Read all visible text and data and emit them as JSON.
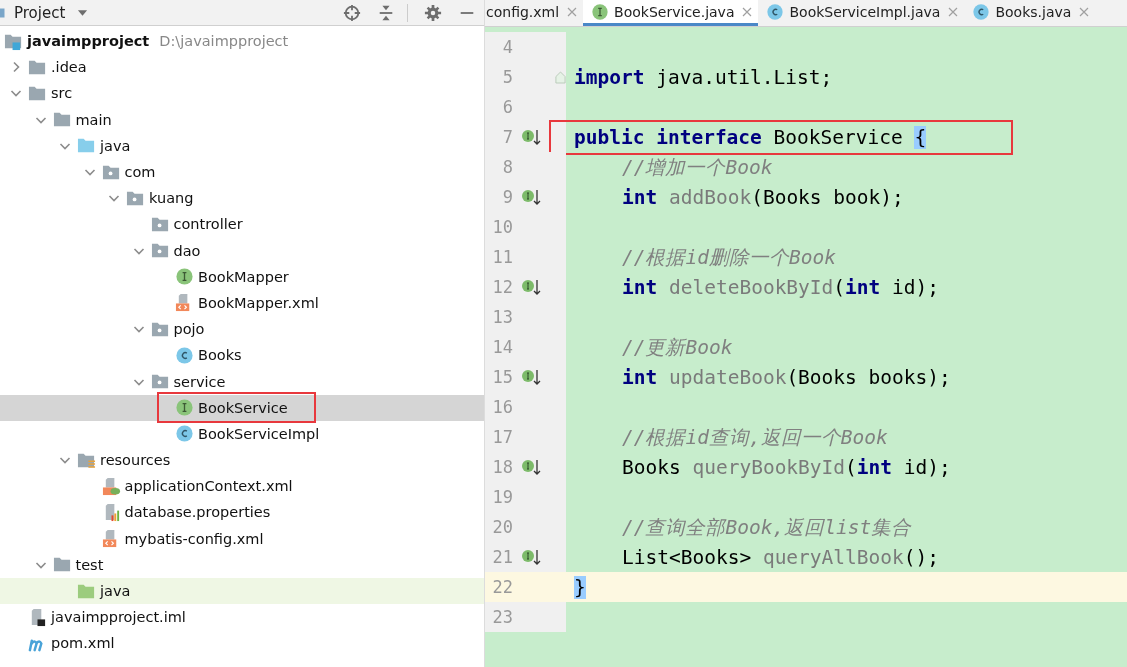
{
  "project_panel": {
    "title": "Project"
  },
  "tree": {
    "name": "javaimpproject",
    "path": "D:\\javaimpproject",
    "kind": "module",
    "selected": false,
    "boxed": false,
    "children": [
      {
        "name": ".idea",
        "kind": "folder",
        "expanded": false,
        "selected": false,
        "boxed": false
      },
      {
        "name": "src",
        "kind": "folder",
        "expanded": true,
        "selected": false,
        "boxed": false,
        "children": [
          {
            "name": "main",
            "kind": "folder",
            "expanded": true,
            "selected": false,
            "boxed": false,
            "children": [
              {
                "name": "java",
                "kind": "source-root",
                "expanded": true,
                "selected": false,
                "boxed": false,
                "children": [
                  {
                    "name": "com",
                    "kind": "package",
                    "expanded": true,
                    "selected": false,
                    "boxed": false,
                    "children": [
                      {
                        "name": "kuang",
                        "kind": "package",
                        "expanded": true,
                        "selected": false,
                        "boxed": false,
                        "children": [
                          {
                            "name": "controller",
                            "kind": "package",
                            "selected": false,
                            "boxed": false
                          },
                          {
                            "name": "dao",
                            "kind": "package",
                            "expanded": true,
                            "selected": false,
                            "boxed": false,
                            "children": [
                              {
                                "name": "BookMapper",
                                "kind": "interface",
                                "selected": false,
                                "boxed": false
                              },
                              {
                                "name": "BookMapper.xml",
                                "kind": "xml",
                                "selected": false,
                                "boxed": false
                              }
                            ]
                          },
                          {
                            "name": "pojo",
                            "kind": "package",
                            "expanded": true,
                            "selected": false,
                            "boxed": false,
                            "children": [
                              {
                                "name": "Books",
                                "kind": "class",
                                "selected": false,
                                "boxed": false
                              }
                            ]
                          },
                          {
                            "name": "service",
                            "kind": "package",
                            "expanded": true,
                            "selected": false,
                            "boxed": false,
                            "children": [
                              {
                                "name": "BookService",
                                "kind": "interface",
                                "selected": true,
                                "boxed": true
                              },
                              {
                                "name": "BookServiceImpl",
                                "kind": "class",
                                "selected": false,
                                "boxed": false
                              }
                            ]
                          }
                        ]
                      }
                    ]
                  }
                ]
              },
              {
                "name": "resources",
                "kind": "resources-root",
                "expanded": true,
                "selected": false,
                "boxed": false,
                "children": [
                  {
                    "name": "applicationContext.xml",
                    "kind": "spring-xml",
                    "selected": false,
                    "boxed": false
                  },
                  {
                    "name": "database.properties",
                    "kind": "properties",
                    "selected": false,
                    "boxed": false
                  },
                  {
                    "name": "mybatis-config.xml",
                    "kind": "xml",
                    "selected": false,
                    "boxed": false
                  }
                ]
              }
            ]
          },
          {
            "name": "test",
            "kind": "folder",
            "expanded": true,
            "selected": false,
            "boxed": false,
            "children": [
              {
                "name": "java",
                "kind": "test-root",
                "selected": false,
                "boxed": false
              }
            ]
          }
        ]
      },
      {
        "name": "javaimpproject.iml",
        "kind": "iml",
        "selected": false,
        "boxed": false
      },
      {
        "name": "pom.xml",
        "kind": "maven",
        "selected": false,
        "boxed": false
      }
    ]
  },
  "tabs": [
    {
      "label": "config.xml",
      "kind": "none",
      "selected": false
    },
    {
      "label": "BookService.java",
      "kind": "interface",
      "selected": true
    },
    {
      "label": "BookServiceImpl.java",
      "kind": "class",
      "selected": false
    },
    {
      "label": "Books.java",
      "kind": "class",
      "selected": false
    }
  ],
  "code_lines": [
    {
      "number": "4",
      "kind": "plain",
      "current": false,
      "boxed": false
    },
    {
      "number": "5",
      "kind": "fold",
      "indented": false,
      "current": false,
      "boxed": false,
      "tokens": [
        {
          "text": "import",
          "kind": "keyword"
        },
        {
          "text": " java.util.List;",
          "kind": "plain"
        }
      ]
    },
    {
      "number": "6",
      "kind": "plain",
      "current": false,
      "boxed": false
    },
    {
      "number": "7",
      "kind": "implemented",
      "indented": false,
      "current": false,
      "boxed": true,
      "tokens": [
        {
          "text": "public interface",
          "kind": "keyword"
        },
        {
          "text": " BookService ",
          "kind": "plain"
        },
        {
          "text": "{",
          "kind": "brace"
        }
      ]
    },
    {
      "number": "8",
      "kind": "plain",
      "indented": true,
      "current": false,
      "boxed": false,
      "tokens": [
        {
          "text": "//增加一个Book",
          "kind": "comment"
        }
      ]
    },
    {
      "number": "9",
      "kind": "implemented",
      "indented": true,
      "current": false,
      "boxed": false,
      "tokens": [
        {
          "text": "int",
          "kind": "keyword"
        },
        {
          "text": " addBook",
          "kind": "method"
        },
        {
          "text": "(Books book);",
          "kind": "plain"
        }
      ]
    },
    {
      "number": "10",
      "kind": "plain",
      "current": false,
      "boxed": false
    },
    {
      "number": "11",
      "kind": "plain",
      "indented": true,
      "current": false,
      "boxed": false,
      "tokens": [
        {
          "text": "//根据id删除一个Book",
          "kind": "comment"
        }
      ]
    },
    {
      "number": "12",
      "kind": "implemented",
      "indented": true,
      "current": false,
      "boxed": false,
      "tokens": [
        {
          "text": "int",
          "kind": "keyword"
        },
        {
          "text": " deleteBookById",
          "kind": "method"
        },
        {
          "text": "(",
          "kind": "plain"
        },
        {
          "text": "int",
          "kind": "keyword"
        },
        {
          "text": " id);",
          "kind": "plain"
        }
      ]
    },
    {
      "number": "13",
      "kind": "plain",
      "current": false,
      "boxed": false
    },
    {
      "number": "14",
      "kind": "plain",
      "indented": true,
      "current": false,
      "boxed": false,
      "tokens": [
        {
          "text": "//更新Book",
          "kind": "comment"
        }
      ]
    },
    {
      "number": "15",
      "kind": "implemented",
      "indented": true,
      "current": false,
      "boxed": false,
      "tokens": [
        {
          "text": "int",
          "kind": "keyword"
        },
        {
          "text": " updateBook",
          "kind": "method"
        },
        {
          "text": "(Books books);",
          "kind": "plain"
        }
      ]
    },
    {
      "number": "16",
      "kind": "plain",
      "current": false,
      "boxed": false
    },
    {
      "number": "17",
      "kind": "plain",
      "indented": true,
      "current": false,
      "boxed": false,
      "tokens": [
        {
          "text": "//根据id查询,返回一个Book",
          "kind": "comment"
        }
      ]
    },
    {
      "number": "18",
      "kind": "implemented",
      "indented": true,
      "current": false,
      "boxed": false,
      "tokens": [
        {
          "text": "Books ",
          "kind": "plain"
        },
        {
          "text": "queryBookById",
          "kind": "method"
        },
        {
          "text": "(",
          "kind": "plain"
        },
        {
          "text": "int",
          "kind": "keyword"
        },
        {
          "text": " id);",
          "kind": "plain"
        }
      ]
    },
    {
      "number": "19",
      "kind": "plain",
      "current": false,
      "boxed": false
    },
    {
      "number": "20",
      "kind": "plain",
      "indented": true,
      "current": false,
      "boxed": false,
      "tokens": [
        {
          "text": "//查询全部Book,返回list集合",
          "kind": "comment"
        }
      ]
    },
    {
      "number": "21",
      "kind": "implemented",
      "indented": true,
      "current": false,
      "boxed": false,
      "tokens": [
        {
          "text": "List<Books> ",
          "kind": "plain"
        },
        {
          "text": "queryAllBook",
          "kind": "method"
        },
        {
          "text": "();",
          "kind": "plain"
        }
      ]
    },
    {
      "number": "22",
      "kind": "plain",
      "indented": false,
      "current": true,
      "boxed": false,
      "tokens": [
        {
          "text": "}",
          "kind": "brace"
        }
      ]
    },
    {
      "number": "23",
      "kind": "plain",
      "current": false,
      "boxed": false
    }
  ]
}
